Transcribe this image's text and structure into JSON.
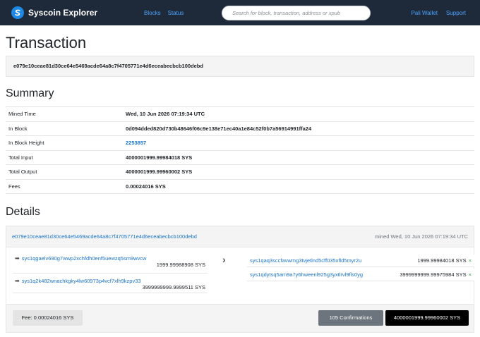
{
  "nav": {
    "brand": "Syscoin Explorer",
    "links": [
      "Blocks",
      "Status"
    ],
    "search_placeholder": "Search for block, transaction, address or xpub",
    "right_links": [
      "Pali Wallet",
      "Support"
    ]
  },
  "page_title": "Transaction",
  "txid": "e079e10ceae81d30ce64e5469acde64a8c7f4705771e4d6eceabecbcb100debd",
  "summary": {
    "heading": "Summary",
    "rows": [
      {
        "label": "Mined Time",
        "value": "Wed, 10 Jun 2026 07:19:34 UTC"
      },
      {
        "label": "In Block",
        "value": "0d094dded820d730b48646f06c9e138e71ec40a1e84c52f0b7a56914991ffa24"
      },
      {
        "label": "In Block Height",
        "value": "2253857"
      },
      {
        "label": "Total Input",
        "value": "4000001999.99984018 SYS"
      },
      {
        "label": "Total Output",
        "value": "4000001999.99960002 SYS"
      },
      {
        "label": "Fees",
        "value": "0.00024016 SYS"
      }
    ]
  },
  "details": {
    "heading": "Details",
    "txid": "e079e10ceae81d30ce64e5469acde64a8c7f4705771e4d6eceabecbcb100debd",
    "mined": "mined Wed, 10 Jun 2026 07:19:34 UTC",
    "inputs": [
      {
        "address": "sys1qgaelv690g7wwp2xchfdh0enf5uewzq5sm9wvcw",
        "amount": "1999.99988908 SYS"
      },
      {
        "address": "sys1q2k482wnachkgky4lw60973p4vcf7xlh9kzpv33",
        "amount": "3999999999.9999511 SYS"
      }
    ],
    "outputs": [
      {
        "address": "sys1qaq3sccfavwmg3tvjetlnd5cff035xfld5myr2u",
        "amount": "1999.99984018 SYS"
      },
      {
        "address": "sys1qdytsq5am9a7y6hweenl925g3yxtlrvl9fls0yg",
        "amount": "3999999999.99975984 SYS"
      }
    ],
    "fee": "Fee: 0.00024016 SYS",
    "confirmations": "105 Confirmations",
    "total": "4000001999.99960002 SYS"
  },
  "icons": {
    "logo": "syscoin-logo-icon",
    "input_arrow": "arrow-right-icon",
    "flow": "chevron-right-icon",
    "spent": "close-icon"
  },
  "colors": {
    "navbar": "#1e2a3a",
    "link": "#1a73c8",
    "brand_accent": "#1e88e5",
    "spent": "#3fa34d"
  }
}
